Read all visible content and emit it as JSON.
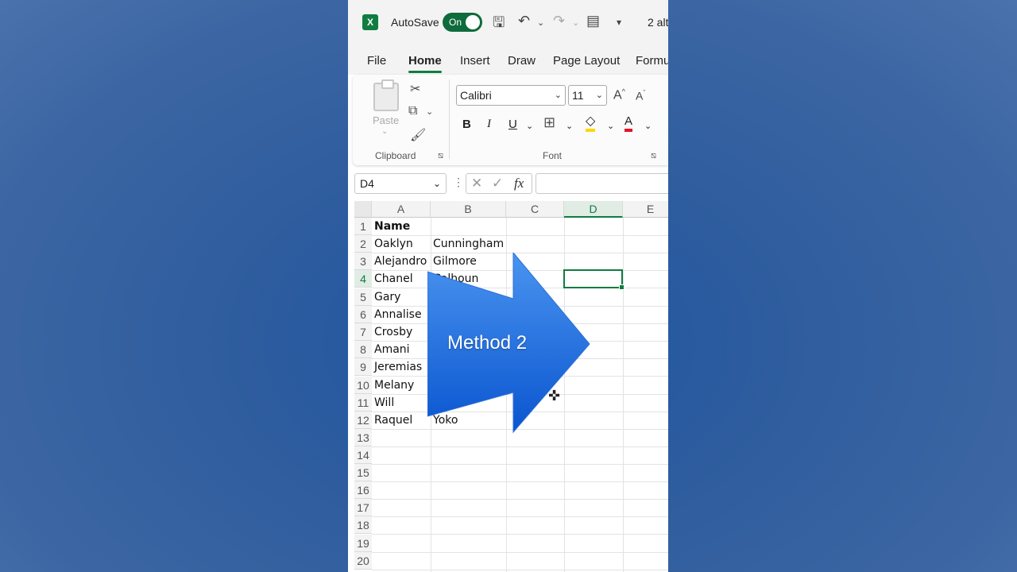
{
  "titlebar": {
    "app_icon": "excel-logo-icon",
    "app_letter": "X",
    "autosave_label": "AutoSave",
    "toggle_label": "On",
    "doc_title": "2 alt"
  },
  "tabs": [
    "File",
    "Home",
    "Insert",
    "Draw",
    "Page Layout",
    "Formu"
  ],
  "ribbon": {
    "paste_label": "Paste",
    "clipboard_label": "Clipboard",
    "font_group_label": "Font",
    "font_name": "Calibri",
    "font_size": "11",
    "grow_label": "A",
    "shrink_label": "A",
    "bold": "B",
    "italic": "I",
    "underline": "U"
  },
  "formula_bar": {
    "name_box": "D4",
    "fx": "fx"
  },
  "columns": [
    "A",
    "B",
    "C",
    "D",
    "E"
  ],
  "rows": [
    "1",
    "2",
    "3",
    "4",
    "5",
    "6",
    "7",
    "8",
    "9",
    "10",
    "11",
    "12",
    "13",
    "14",
    "15",
    "16",
    "17",
    "18",
    "19",
    "20"
  ],
  "cells": {
    "A1": "Name",
    "A2": "Oaklyn",
    "B2": "Cunningham",
    "A3": "Alejandro",
    "B3": "Gilmore",
    "A4": "Chanel",
    "B4": "Calhoun",
    "A5": "Gary",
    "A6": "Annalise",
    "A7": "Crosby",
    "A8": "Amani",
    "A9": "Jeremias",
    "A10": "Melany",
    "A11": "Will",
    "A12": "Raquel",
    "B12": "Yoko"
  },
  "overlay": {
    "label": "Method 2",
    "arrow_color_top": "#4a94f0",
    "arrow_color_bottom": "#0a55cf"
  },
  "colors": {
    "excel_green": "#107c41",
    "background_blue": "#2f5d9e"
  }
}
